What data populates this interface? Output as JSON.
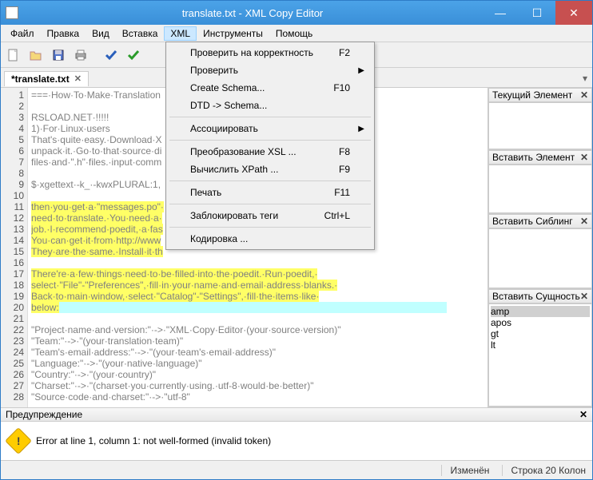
{
  "title": "translate.txt - XML Copy Editor",
  "menubar": [
    "Файл",
    "Правка",
    "Вид",
    "Вставка",
    "XML",
    "Инструменты",
    "Помощь"
  ],
  "active_menu_index": 4,
  "tab": {
    "label": "*translate.txt"
  },
  "dropdown": [
    {
      "label": "Проверить на корректность",
      "shortcut": "F2"
    },
    {
      "label": "Проверить",
      "submenu": true
    },
    {
      "label": "Create Schema...",
      "shortcut": "F10"
    },
    {
      "label": "DTD -> Schema..."
    },
    {
      "sep": true
    },
    {
      "label": "Ассоциировать",
      "submenu": true
    },
    {
      "sep": true
    },
    {
      "label": "Преобразование XSL ...",
      "shortcut": "F8"
    },
    {
      "label": "Вычислить XPath ...",
      "shortcut": "F9"
    },
    {
      "sep": true
    },
    {
      "label": "Печать",
      "shortcut": "F11"
    },
    {
      "sep": true
    },
    {
      "label": "Заблокировать теги",
      "shortcut": "Ctrl+L"
    },
    {
      "sep": true
    },
    {
      "label": "Кодировка ..."
    }
  ],
  "lines": [
    "===·How·To·Make·Translation",
    "",
    "RSLOAD.NET·!!!!!",
    "1)·For·Linux·users",
    "That's·quite·easy.·Download·X",
    "unpack·it.·Go·to·that·source·di",
    "files·and·\".h\"·files.·input·comm",
    "",
    "$·xgettext·-k_·-kwxPLURAL:1,",
    "",
    "then·you·get·a·\"messages.po\"·",
    "need·to·translate.·You·need·a·",
    "job.·I·recommend·poedit,·a·fas",
    "You·can·get·it·from·http://www",
    "They·are·the·same.·Install·it·th",
    "",
    "There're·a·few·things·need·to·be·filled·into·the·poedit.·Run·poedit,·",
    "select·\"File\"-\"Preferences\",·fill·in·your·name·and·email·address·blanks.·",
    "Back·to·main·window,·select·\"Catalog\"-\"Settings\",·fill·the·items·like·",
    "below:",
    "",
    "\"Project·name·and·version:\"·->·\"XML·Copy·Editor·(your·source·version)\"",
    "\"Team:\"·->·\"(your·translation·team)\"",
    "\"Team's·email·address:\"·->·\"(your·team's·email·address)\"",
    "\"Language:\"·->·\"(your·native·language)\"",
    "\"Country:\"·->·\"(your·country)\"",
    "\"Charset:\"·->·\"(charset·you·currently·using.·utf-8·would·be·better)\"",
    "\"Source·code·and·charset:\"·->·\"utf-8\""
  ],
  "highlighted_lines": [
    10,
    11,
    12,
    13,
    14,
    16,
    17,
    18,
    19
  ],
  "cursor_line": 19,
  "panels": {
    "p1": "Текущий Элемент",
    "p2": "Вставить Элемент",
    "p3": "Вставить Сиблинг",
    "p4": "Вставить Сущность"
  },
  "entities": [
    "amp",
    "apos",
    "gt",
    "lt"
  ],
  "warning": {
    "title": "Предупреждение",
    "text": "Error at line 1, column 1: not well-formed (invalid token)"
  },
  "status": {
    "modified": "Изменён",
    "pos": "Строка 20 Колон"
  }
}
